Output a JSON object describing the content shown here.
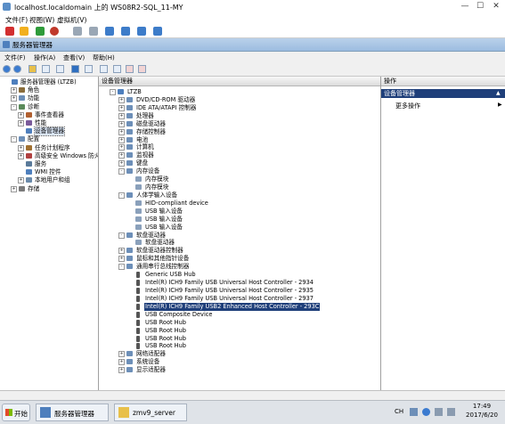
{
  "vm": {
    "title": "localhost.localdomain 上的 WS08R2-SQL_11-MY",
    "menu": [
      "文件(F)",
      "视图(W)",
      "虚拟机(V)"
    ],
    "min": "—",
    "max": "☐",
    "close": "✕"
  },
  "window": {
    "title": "服务器管理器",
    "menu": [
      "文件(F)",
      "操作(A)",
      "查看(V)",
      "帮助(H)"
    ]
  },
  "left_tree": [
    {
      "label": "服务器管理器 (LTZB)",
      "level": 0,
      "exp": ""
    },
    {
      "label": "角色",
      "level": 1,
      "exp": "+"
    },
    {
      "label": "功能",
      "level": 1,
      "exp": "+"
    },
    {
      "label": "诊断",
      "level": 1,
      "exp": "-"
    },
    {
      "label": "事件查看器",
      "level": 2,
      "exp": "+"
    },
    {
      "label": "性能",
      "level": 2,
      "exp": "+"
    },
    {
      "label": "设备管理器",
      "level": 2,
      "exp": "",
      "selected": true
    },
    {
      "label": "配置",
      "level": 1,
      "exp": "-"
    },
    {
      "label": "任务计划程序",
      "level": 2,
      "exp": "+"
    },
    {
      "label": "高级安全 Windows 防火",
      "level": 2,
      "exp": "+"
    },
    {
      "label": "服务",
      "level": 2,
      "exp": ""
    },
    {
      "label": "WMI 控件",
      "level": 2,
      "exp": ""
    },
    {
      "label": "本地用户和组",
      "level": 2,
      "exp": "+"
    },
    {
      "label": "存储",
      "level": 1,
      "exp": "+"
    }
  ],
  "center": {
    "header": "设备管理器",
    "rows": [
      {
        "label": "LTZB",
        "level": 0,
        "exp": "-"
      },
      {
        "label": "DVD/CD-ROM 驱动器",
        "level": 1,
        "exp": "+"
      },
      {
        "label": "IDE ATA/ATAPI 控制器",
        "level": 1,
        "exp": "+"
      },
      {
        "label": "处理器",
        "level": 1,
        "exp": "+"
      },
      {
        "label": "磁盘驱动器",
        "level": 1,
        "exp": "+"
      },
      {
        "label": "存储控制器",
        "level": 1,
        "exp": "+"
      },
      {
        "label": "电池",
        "level": 1,
        "exp": "+"
      },
      {
        "label": "计算机",
        "level": 1,
        "exp": "+"
      },
      {
        "label": "监视器",
        "level": 1,
        "exp": "+"
      },
      {
        "label": "键盘",
        "level": 1,
        "exp": "+"
      },
      {
        "label": "内存设备",
        "level": 1,
        "exp": "-"
      },
      {
        "label": "内存模块",
        "level": 2,
        "exp": ""
      },
      {
        "label": "内存模块",
        "level": 2,
        "exp": ""
      },
      {
        "label": "人体学输入设备",
        "level": 1,
        "exp": "-"
      },
      {
        "label": "HID-compliant device",
        "level": 2,
        "exp": ""
      },
      {
        "label": "USB 输入设备",
        "level": 2,
        "exp": ""
      },
      {
        "label": "USB 输入设备",
        "level": 2,
        "exp": ""
      },
      {
        "label": "USB 输入设备",
        "level": 2,
        "exp": ""
      },
      {
        "label": "软盘驱动器",
        "level": 1,
        "exp": "-"
      },
      {
        "label": "软盘驱动器",
        "level": 2,
        "exp": ""
      },
      {
        "label": "软盘驱动器控制器",
        "level": 1,
        "exp": "+"
      },
      {
        "label": "鼠标和其他指针设备",
        "level": 1,
        "exp": "+"
      },
      {
        "label": "通用串行总线控制器",
        "level": 1,
        "exp": "-"
      },
      {
        "label": "Generic USB Hub",
        "level": 2,
        "exp": "",
        "usb": true
      },
      {
        "label": "Intel(R) ICH9 Family USB Universal Host Controller - 2934",
        "level": 2,
        "exp": "",
        "usb": true
      },
      {
        "label": "Intel(R) ICH9 Family USB Universal Host Controller - 2935",
        "level": 2,
        "exp": "",
        "usb": true
      },
      {
        "label": "Intel(R) ICH9 Family USB Universal Host Controller - 2937",
        "level": 2,
        "exp": "",
        "usb": true
      },
      {
        "label": "Intel(R) ICH9 Family USB2 Enhanced Host Controller - 293C",
        "level": 2,
        "exp": "",
        "usb": true,
        "selected": true
      },
      {
        "label": "USB Composite Device",
        "level": 2,
        "exp": "",
        "usb": true
      },
      {
        "label": "USB Root Hub",
        "level": 2,
        "exp": "",
        "usb": true
      },
      {
        "label": "USB Root Hub",
        "level": 2,
        "exp": "",
        "usb": true
      },
      {
        "label": "USB Root Hub",
        "level": 2,
        "exp": "",
        "usb": true
      },
      {
        "label": "USB Root Hub",
        "level": 2,
        "exp": "",
        "usb": true
      },
      {
        "label": "网络适配器",
        "level": 1,
        "exp": "+"
      },
      {
        "label": "系统设备",
        "level": 1,
        "exp": "+"
      },
      {
        "label": "显示适配器",
        "level": 1,
        "exp": "+"
      }
    ]
  },
  "actions": {
    "header": "操作",
    "section": "设备管理器",
    "more": "更多操作"
  },
  "taskbar": {
    "start": "开始",
    "items": [
      "服务器管理器",
      "zmv9_server"
    ],
    "lang": "CH",
    "time": "17:49",
    "date": "2017/6/20"
  },
  "colors": {
    "accent": "#1f3f7a",
    "tree_folder": "#e8c04a",
    "title_grad": "#b9d1ea"
  }
}
